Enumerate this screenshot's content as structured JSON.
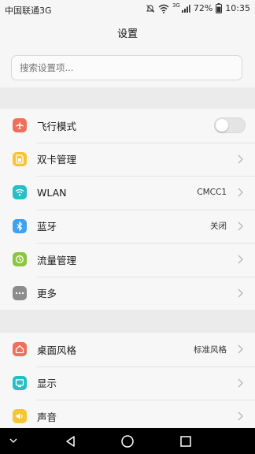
{
  "status_bar": {
    "carrier": "中国联通3G",
    "network": "3G",
    "battery": "72%",
    "time": "10:35"
  },
  "header": {
    "title": "设置"
  },
  "search": {
    "placeholder": "搜索设置项..."
  },
  "groups": [
    {
      "items": [
        {
          "label": "飞行模式",
          "icon": "airplane-icon",
          "color": "#ef6f5b",
          "toggle": false
        },
        {
          "label": "双卡管理",
          "icon": "sim-card-icon",
          "color": "#f7c531"
        },
        {
          "label": "WLAN",
          "icon": "wifi-icon",
          "color": "#23c0c6",
          "value": "CMCC1"
        },
        {
          "label": "蓝牙",
          "icon": "bluetooth-icon",
          "color": "#3ea2f2",
          "value": "关闭"
        },
        {
          "label": "流量管理",
          "icon": "data-usage-icon",
          "color": "#8cc63e"
        },
        {
          "label": "更多",
          "icon": "more-icon",
          "color": "#8c8c8c"
        }
      ]
    },
    {
      "items": [
        {
          "label": "桌面风格",
          "icon": "home-style-icon",
          "color": "#ef6f5b",
          "value": "标准风格"
        },
        {
          "label": "显示",
          "icon": "display-icon",
          "color": "#23c0c6"
        },
        {
          "label": "声音",
          "icon": "sound-icon",
          "color": "#f7c531"
        }
      ]
    }
  ],
  "nav_bar": {
    "buttons": [
      "back-icon",
      "home-icon",
      "recents-icon"
    ]
  }
}
